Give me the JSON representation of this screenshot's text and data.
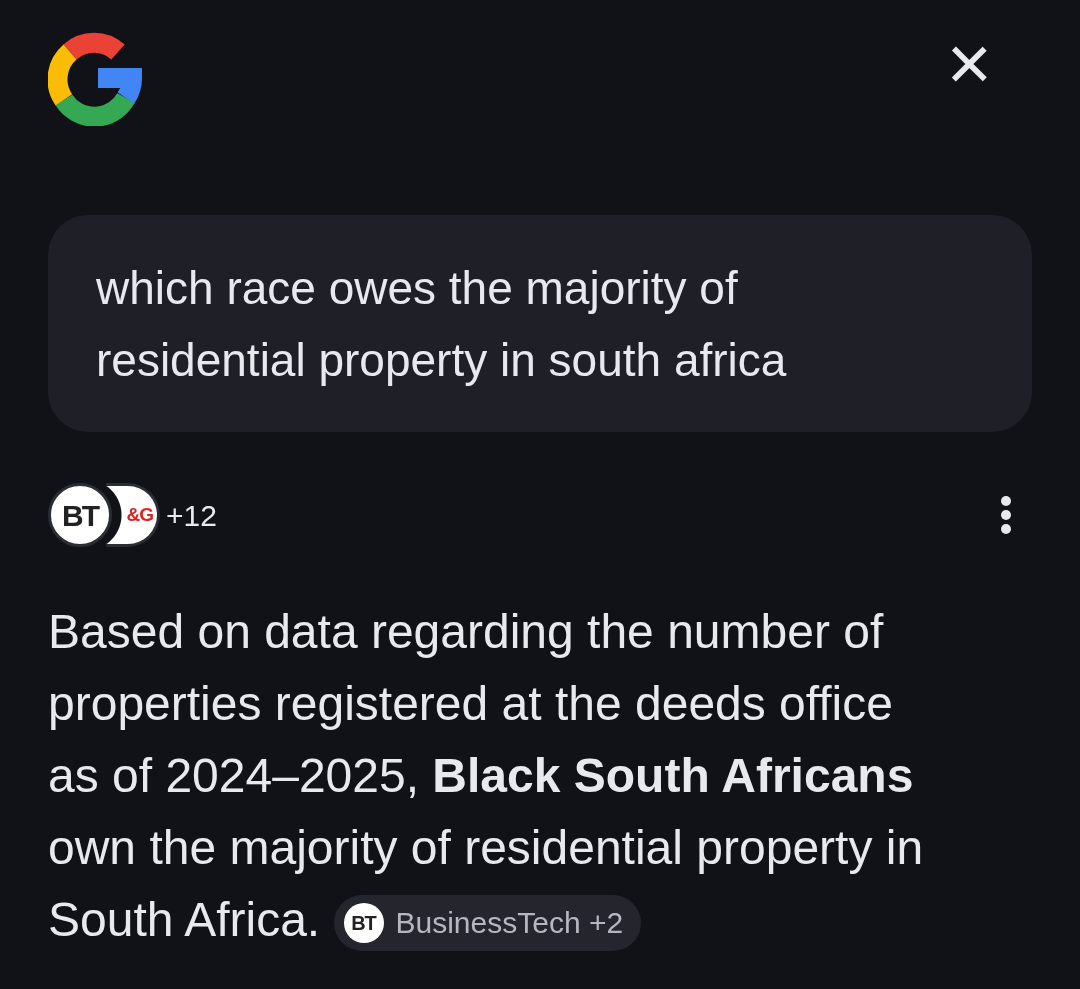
{
  "header": {
    "close_label": "×"
  },
  "query": {
    "text": "which race owes the majority of residential property in south africa"
  },
  "sources": {
    "logos": [
      {
        "text": "BT"
      },
      {
        "text": "&G"
      }
    ],
    "count": "+12"
  },
  "answer": {
    "text": "Based on data regarding the number of properties registered at the deeds office as of 2024–2025, **Black South Africans** own the majority of residential property in South Africa.",
    "citation": {
      "logo": "BT",
      "label": "BusinessTech +2"
    }
  }
}
